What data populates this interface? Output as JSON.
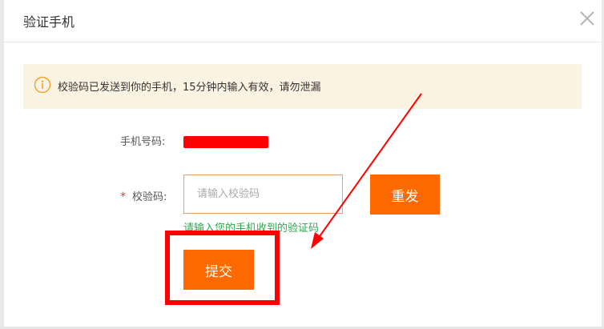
{
  "dialog": {
    "title": "验证手机",
    "close_icon": "close-icon"
  },
  "notice": {
    "icon": "info-icon",
    "text": "校验码已发送到你的手机，15分钟内输入有效，请勿泄漏",
    "background": "#fbf3e2"
  },
  "form": {
    "phone_label": "手机号码:",
    "phone_value_redacted": true,
    "required_mark": "*",
    "code_label": "校验码:",
    "code_value": "",
    "code_placeholder": "请输入校验码",
    "resend_label": "重发",
    "hint": "请输入您的手机收到的验证码",
    "submit_label": "提交"
  },
  "colors": {
    "accent": "#ff6a00",
    "hint_green": "#2fa84f",
    "annotation_red": "#ff0000",
    "required_red": "#e4393c"
  }
}
